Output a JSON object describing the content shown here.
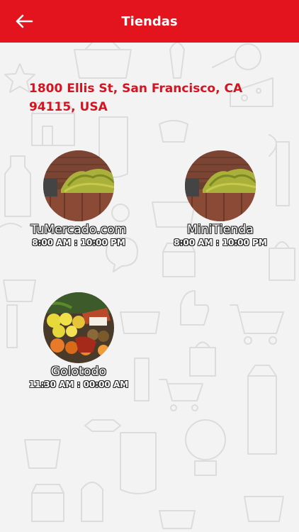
{
  "header": {
    "title": "Tiendas",
    "back_icon": "arrow-left-icon",
    "color": "#e3141e"
  },
  "address": "1800 Ellis St, San Francisco, CA 94115, USA",
  "stores": [
    {
      "name": "TuMercado.com",
      "hours": "8:00 AM : 10:00 PM",
      "image": "bananas-market-stall"
    },
    {
      "name": "MiniTienda",
      "hours": "8:00 AM : 10:00 PM",
      "image": "bananas-market-stall"
    },
    {
      "name": "Golotodo",
      "hours": "11:30 AM : 00:00 AM",
      "image": "fruit-vegetable-stand"
    }
  ],
  "colors": {
    "accent": "#e3141e",
    "address": "#d41420",
    "background": "#f3f3f3"
  }
}
